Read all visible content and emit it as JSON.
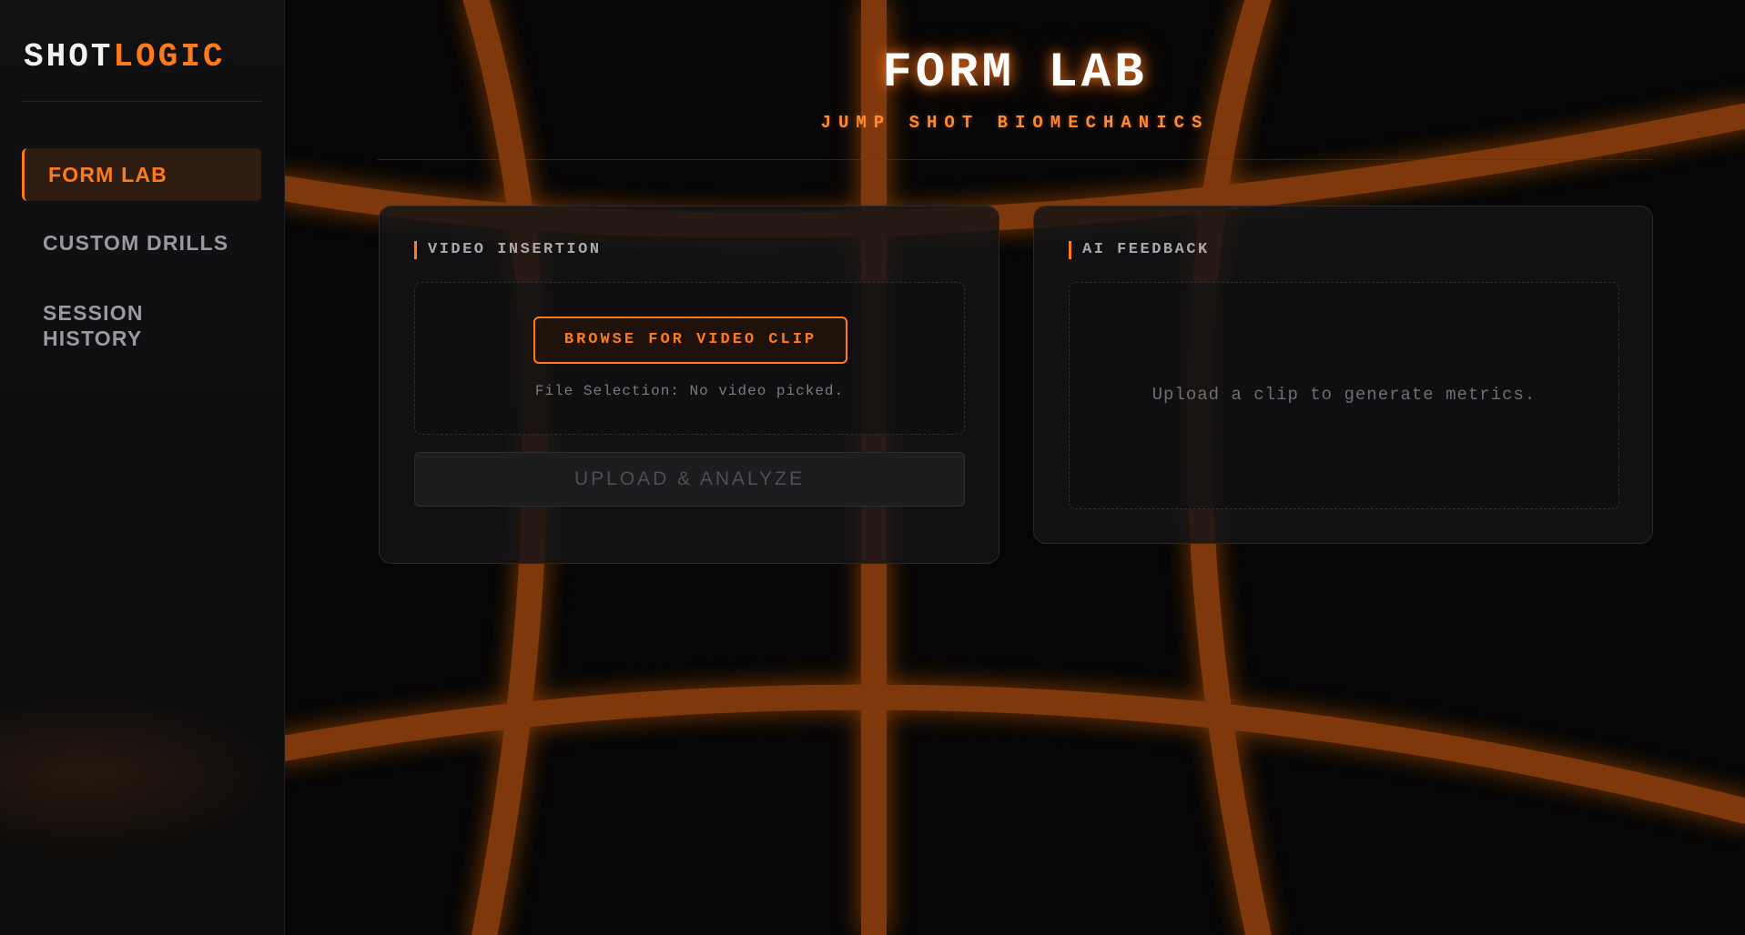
{
  "brand": {
    "part1": "SHOT",
    "part2": "LOGIC"
  },
  "sidebar": {
    "items": [
      {
        "label": "FORM LAB",
        "active": true
      },
      {
        "label": "CUSTOM DRILLS",
        "active": false
      },
      {
        "label": "SESSION HISTORY",
        "active": false
      }
    ]
  },
  "header": {
    "title": "FORM LAB",
    "subtitle": "JUMP SHOT BIOMECHANICS"
  },
  "video_panel": {
    "label": "VIDEO INSERTION",
    "browse_label": "BROWSE FOR VIDEO CLIP",
    "file_status": "File Selection: No video picked.",
    "upload_label": "UPLOAD & ANALYZE",
    "upload_enabled": false
  },
  "ai_panel": {
    "label": "AI FEEDBACK",
    "placeholder": "Upload a clip to generate metrics."
  },
  "colors": {
    "accent": "#ff7a1a",
    "background": "#060606",
    "court_line": "#8a3d08"
  }
}
